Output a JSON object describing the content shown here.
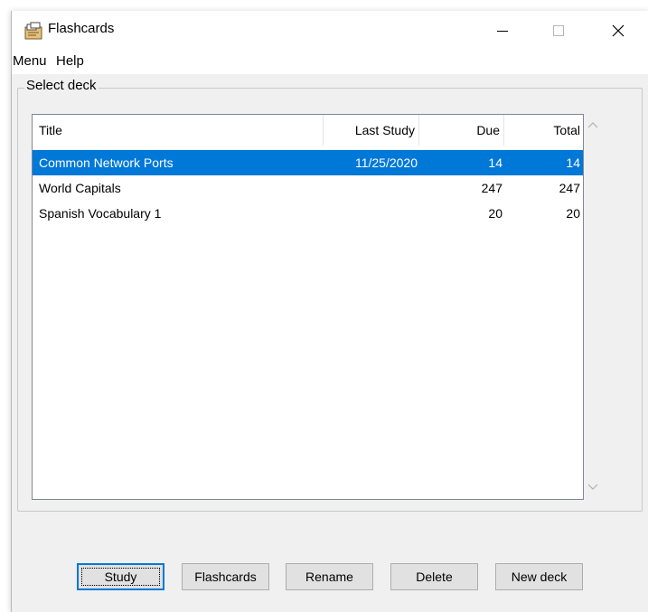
{
  "window": {
    "title": "Flashcards",
    "minimize_glyph": "—",
    "maximize_glyph": "☐",
    "close_glyph": "✕"
  },
  "menu": [
    "Menu",
    "Help"
  ],
  "group_label": "Select deck",
  "columns": [
    "Title",
    "Last Study",
    "Due",
    "Total"
  ],
  "decks": [
    {
      "title": "Common Network Ports",
      "last_study": "11/25/2020",
      "due": "14",
      "total": "14",
      "selected": true
    },
    {
      "title": "World Capitals",
      "last_study": "",
      "due": "247",
      "total": "247",
      "selected": false
    },
    {
      "title": "Spanish Vocabulary 1",
      "last_study": "",
      "due": "20",
      "total": "20",
      "selected": false
    }
  ],
  "buttons": [
    "Study",
    "Flashcards",
    "Rename",
    "Delete",
    "New deck"
  ],
  "colors": {
    "selection": "#0078d7",
    "window_bg": "#f0f0f0",
    "button_bg": "#e1e1e1"
  },
  "icons": {
    "app": "flashcards-deck-icon",
    "scroll_up": "chevron-up-icon",
    "scroll_down": "chevron-down-icon"
  }
}
